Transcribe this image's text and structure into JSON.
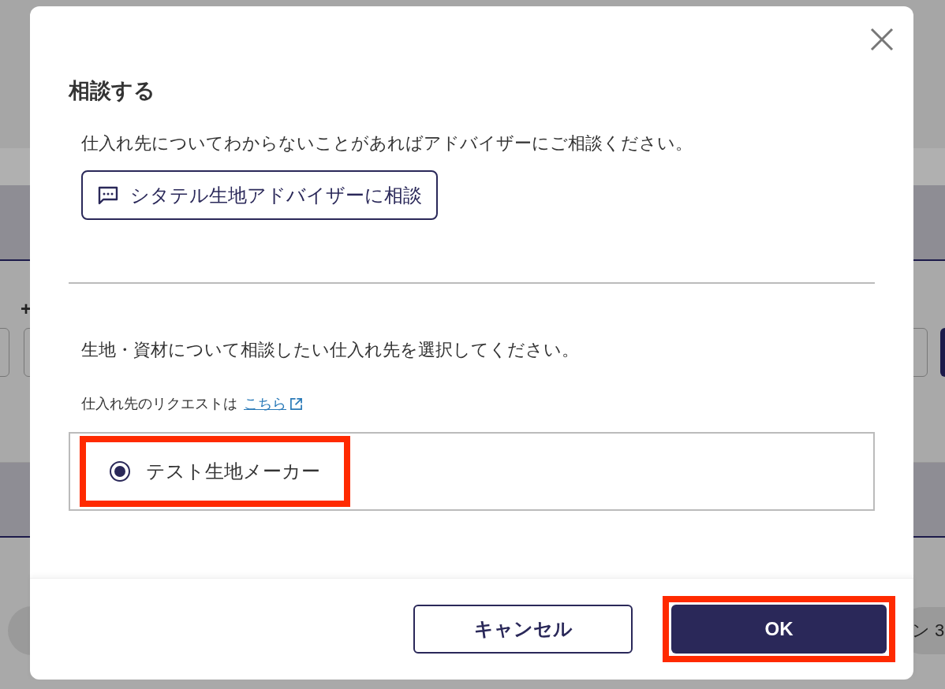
{
  "background": {
    "fragment_left": "+",
    "fragment_right": "ン 3"
  },
  "dialog": {
    "title": "相談する",
    "intro": "仕入れ先についてわからないことがあればアドバイザーにご相談ください。",
    "advisor_button": "シタテル生地アドバイザーに相談",
    "prompt": "生地・資材について相談したい仕入れ先を選択してください。",
    "request_note": "仕入れ先のリクエストは",
    "request_link": "こちら",
    "suppliers": [
      {
        "label": "テスト生地メーカー",
        "selected": true,
        "highlighted": true
      }
    ],
    "buttons": [
      {
        "kind": "secondary",
        "label": "キャンセル",
        "highlighted": false
      },
      {
        "kind": "primary",
        "label": "OK",
        "highlighted": true
      }
    ]
  }
}
